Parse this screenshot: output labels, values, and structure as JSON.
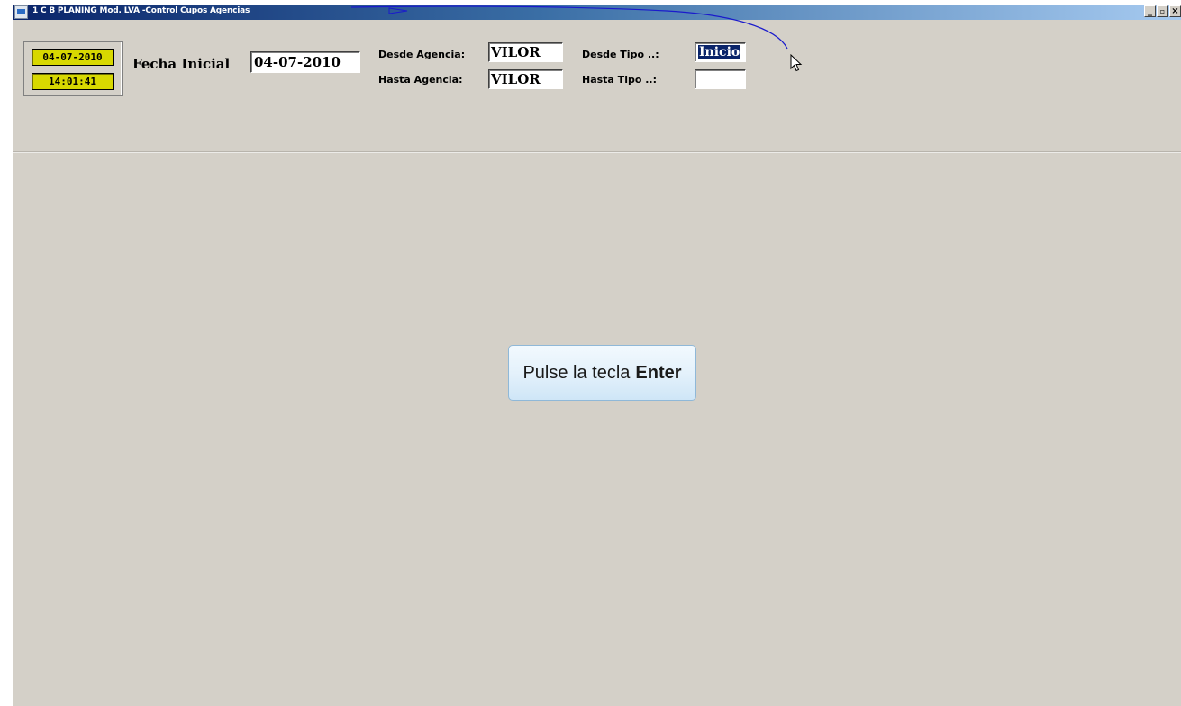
{
  "window": {
    "title": "1 C B PLANING Mod. LVA -Control Cupos Agencias",
    "controls": {
      "minimize": "_",
      "restore": "ô",
      "close": "×"
    }
  },
  "clock": {
    "date": "04-07-2010",
    "time": "14:01:41"
  },
  "form": {
    "fecha_inicial_label": "Fecha Inicial",
    "fecha_inicial_value": "04-07-2010",
    "desde_agencia_label": "Desde Agencia:",
    "desde_agencia_value": "VILOR",
    "hasta_agencia_label": "Hasta Agencia:",
    "hasta_agencia_value": "VILOR",
    "desde_tipo_label": "Desde Tipo ..:",
    "desde_tipo_value": "Inicio",
    "hasta_tipo_label": "Hasta Tipo ..:",
    "hasta_tipo_value": ""
  },
  "hint": {
    "prefix": "Pulse la tecla",
    "key": "Enter"
  },
  "colors": {
    "window_bg": "#d4d0c8",
    "clock_bg": "#d8d800",
    "selection": "#0a246a",
    "annotation_stroke": "#1a1acc"
  },
  "icons": {
    "app": "app-icon",
    "cursor": "mouse-pointer-icon"
  }
}
